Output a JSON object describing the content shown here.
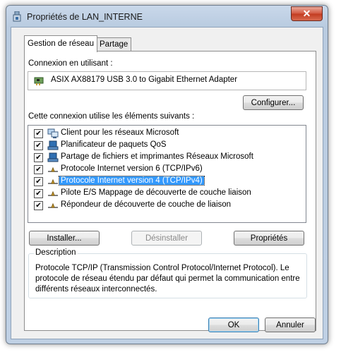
{
  "window": {
    "title": "Propriétés de LAN_INTERNE",
    "close_label": "✕"
  },
  "tabs": [
    {
      "label": "Gestion de réseau",
      "active": true
    },
    {
      "label": "Partage",
      "active": false
    }
  ],
  "connection": {
    "label": "Connexion en utilisant :",
    "adapter": "ASIX AX88179 USB 3.0 to Gigabit Ethernet Adapter",
    "configure_button": "Configurer..."
  },
  "components": {
    "label": "Cette connexion utilise les éléments suivants :",
    "items": [
      {
        "label": "Client pour les réseaux Microsoft",
        "checked": true,
        "icon": "network-client-icon"
      },
      {
        "label": "Planificateur de paquets QoS",
        "checked": true,
        "icon": "network-service-icon"
      },
      {
        "label": "Partage de fichiers et imprimantes Réseaux Microsoft",
        "checked": true,
        "icon": "network-service-icon"
      },
      {
        "label": "Protocole Internet version 6 (TCP/IPv6)",
        "checked": true,
        "icon": "network-protocol-icon"
      },
      {
        "label": "Protocole Internet version 4 (TCP/IPv4)",
        "checked": true,
        "icon": "network-protocol-icon",
        "selected": true
      },
      {
        "label": "Pilote E/S Mappage de découverte de couche liaison",
        "checked": true,
        "icon": "network-protocol-icon"
      },
      {
        "label": "Répondeur de découverte de couche de liaison",
        "checked": true,
        "icon": "network-protocol-icon"
      }
    ],
    "check_mark": "✔"
  },
  "buttons": {
    "install": "Installer...",
    "uninstall": "Désinstaller",
    "properties": "Propriétés",
    "ok": "OK",
    "cancel": "Annuler"
  },
  "description": {
    "legend": "Description",
    "text": "Protocole TCP/IP (Transmission Control Protocol/Internet Protocol). Le protocole de réseau étendu par défaut qui permet la communication entre différents réseaux interconnectés."
  },
  "colors": {
    "selection": "#3399ff",
    "close_button": "#c23b20",
    "window_frame": "#b9cbe0"
  }
}
